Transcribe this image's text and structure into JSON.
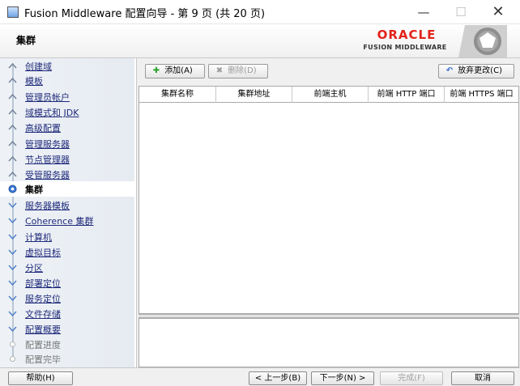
{
  "window": {
    "title": "Fusion Middleware 配置向导 - 第 9 页 (共 20 页)",
    "minimize_icon": "minimize-icon",
    "maximize_icon": "maximize-icon",
    "close_icon": "close-icon"
  },
  "header": {
    "page_title": "集群",
    "brand": "ORACLE",
    "product": "FUSION MIDDLEWARE",
    "brand_color": "#e2231a"
  },
  "nav": {
    "items": [
      {
        "label": "创建域",
        "state": "done"
      },
      {
        "label": "模板",
        "state": "done"
      },
      {
        "label": "管理员帐户",
        "state": "done"
      },
      {
        "label": "域模式和 JDK",
        "state": "done"
      },
      {
        "label": "高级配置",
        "state": "done"
      },
      {
        "label": "管理服务器",
        "state": "done"
      },
      {
        "label": "节点管理器",
        "state": "done"
      },
      {
        "label": "受管服务器",
        "state": "done"
      },
      {
        "label": "集群",
        "state": "active"
      },
      {
        "label": "服务器模板",
        "state": "todo"
      },
      {
        "label": "Coherence 集群",
        "state": "todo"
      },
      {
        "label": "计算机",
        "state": "todo"
      },
      {
        "label": "虚拟目标",
        "state": "todo"
      },
      {
        "label": "分区",
        "state": "todo"
      },
      {
        "label": "部署定位",
        "state": "todo"
      },
      {
        "label": "服务定位",
        "state": "todo"
      },
      {
        "label": "文件存储",
        "state": "todo"
      },
      {
        "label": "配置概要",
        "state": "todo"
      },
      {
        "label": "配置进度",
        "state": "disabled"
      },
      {
        "label": "配置完毕",
        "state": "disabled"
      }
    ]
  },
  "toolbar": {
    "add_label": "添加(A)",
    "delete_label": "删除(D)",
    "discard_label": "放弃更改(C)"
  },
  "table": {
    "columns": [
      "集群名称",
      "集群地址",
      "前端主机",
      "前端 HTTP 端口",
      "前端 HTTPS 端口"
    ]
  },
  "footer": {
    "help_label": "帮助(H)",
    "back_label": "< 上一步(B)",
    "next_label": "下一步(N) >",
    "finish_label": "完成(F)",
    "cancel_label": "取消"
  }
}
